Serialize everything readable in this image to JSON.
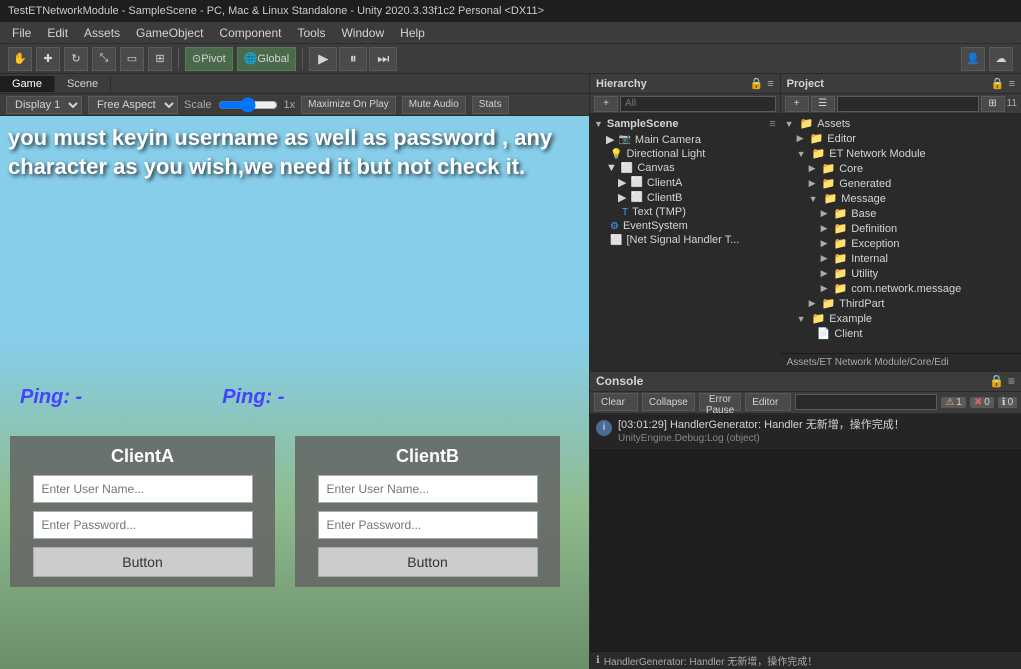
{
  "titlebar": {
    "text": "TestETNetworkModule - SampleScene - PC, Mac & Linux Standalone - Unity 2020.3.33f1c2 Personal <DX11>"
  },
  "menubar": {
    "items": [
      "File",
      "Edit",
      "Assets",
      "GameObject",
      "Component",
      "Tools",
      "Window",
      "Help"
    ]
  },
  "toolbar": {
    "tools": [
      "hand",
      "move",
      "rotate",
      "scale",
      "rect",
      "transform",
      "custom"
    ],
    "pivot_label": "Pivot",
    "global_label": "Global",
    "play_label": "Play",
    "pause_icon": "⏸",
    "step_icon": "⏭",
    "collab_icon": "☁",
    "account_icon": "👤"
  },
  "left_panel": {
    "tabs": [
      {
        "label": "Game",
        "active": true
      },
      {
        "label": "Scene",
        "active": false
      }
    ],
    "toolbar": {
      "display_label": "Display 1",
      "aspect_label": "Free Aspect",
      "scale_label": "Scale",
      "scale_value": "1x",
      "maximize_label": "Maximize On Play",
      "mute_label": "Mute Audio",
      "stats_label": "Stats"
    },
    "game_text": "you must keyin username as well as password , any character as you wish,we need it but not check it.",
    "ping_left": "Ping: -",
    "ping_right": "Ping: -",
    "client_a": {
      "title": "ClientA",
      "username_placeholder": "Enter User Name...",
      "password_placeholder": "Enter Password...",
      "button_label": "Button"
    },
    "client_b": {
      "title": "ClientB",
      "username_placeholder": "Enter User Name...",
      "password_placeholder": "Enter Password...",
      "button_label": "Button"
    }
  },
  "hierarchy": {
    "title": "Hierarchy",
    "search_placeholder": "All",
    "scene_name": "SampleScene",
    "items": [
      {
        "label": "SampleScene",
        "depth": 0,
        "type": "scene"
      },
      {
        "label": "Main Camera",
        "depth": 1,
        "type": "object"
      },
      {
        "label": "Directional Light",
        "depth": 1,
        "type": "object"
      },
      {
        "label": "Canvas",
        "depth": 1,
        "type": "object"
      },
      {
        "label": "ClientA",
        "depth": 2,
        "type": "object"
      },
      {
        "label": "ClientB",
        "depth": 2,
        "type": "object"
      },
      {
        "label": "Text (TMP)",
        "depth": 2,
        "type": "object"
      },
      {
        "label": "EventSystem",
        "depth": 1,
        "type": "object"
      },
      {
        "label": "[Net Signal Handler T...",
        "depth": 1,
        "type": "object"
      }
    ]
  },
  "project": {
    "title": "Project",
    "search_placeholder": "",
    "breadcrumb": "Assets/ET Network Module/Core/Edi",
    "items": [
      {
        "label": "Assets",
        "depth": 0,
        "type": "folder",
        "expanded": true
      },
      {
        "label": "Editor",
        "depth": 1,
        "type": "folder"
      },
      {
        "label": "ET Network Module",
        "depth": 1,
        "type": "folder",
        "expanded": true
      },
      {
        "label": "Core",
        "depth": 2,
        "type": "folder"
      },
      {
        "label": "Generated",
        "depth": 2,
        "type": "folder"
      },
      {
        "label": "Message",
        "depth": 2,
        "type": "folder",
        "expanded": true
      },
      {
        "label": "Base",
        "depth": 3,
        "type": "folder"
      },
      {
        "label": "Definition",
        "depth": 3,
        "type": "folder"
      },
      {
        "label": "Exception",
        "depth": 3,
        "type": "folder"
      },
      {
        "label": "Internal",
        "depth": 3,
        "type": "folder"
      },
      {
        "label": "Utility",
        "depth": 3,
        "type": "folder"
      },
      {
        "label": "com.network.message",
        "depth": 3,
        "type": "folder"
      },
      {
        "label": "ThirdPart",
        "depth": 2,
        "type": "folder"
      },
      {
        "label": "Example",
        "depth": 1,
        "type": "folder",
        "expanded": true
      },
      {
        "label": "Client",
        "depth": 2,
        "type": "file"
      }
    ]
  },
  "console": {
    "title": "Console",
    "buttons": {
      "clear": "Clear",
      "collapse": "Collapse",
      "error_pause": "Error Pause",
      "editor": "Editor"
    },
    "counts": {
      "warn": "1",
      "error": "0",
      "info": "0"
    },
    "entries": [
      {
        "type": "info",
        "message": "[03:01:29] HandlerGenerator: Handler 无新增，操作完成！",
        "sub": "UnityEngine.Debug:Log (object)"
      }
    ]
  },
  "statusbar": {
    "text": "HandlerGenerator: Handler 无新增，操作完成！"
  },
  "icons": {
    "network_module": "Network Module"
  }
}
